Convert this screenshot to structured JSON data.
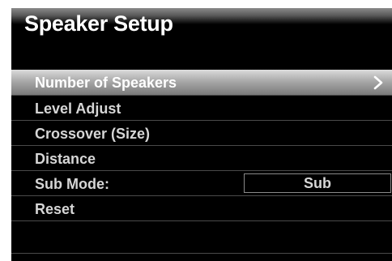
{
  "title": "Speaker Setup",
  "menu": {
    "items": [
      {
        "label": "Number of Speakers",
        "selected": true,
        "icon": "chevron-right-icon"
      },
      {
        "label": "Level Adjust"
      },
      {
        "label": "Crossover (Size)"
      },
      {
        "label": "Distance"
      },
      {
        "label": "Sub Mode:",
        "value": "Sub"
      },
      {
        "label": "Reset"
      }
    ]
  },
  "colors": {
    "background": "#000000",
    "text": "#d6d6d6",
    "selected_text": "#ffffff",
    "divider": "#4a4a4a"
  }
}
